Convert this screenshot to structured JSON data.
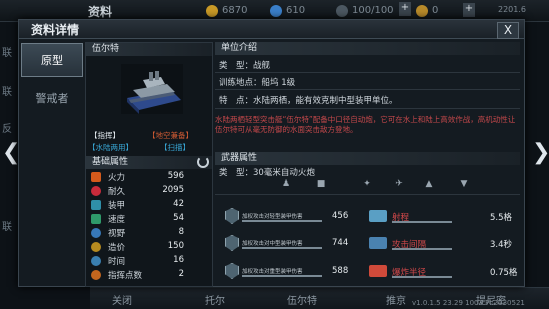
{
  "hud": {
    "title": "资料",
    "gold": "6870",
    "gems": "610",
    "energy": "100/100",
    "plus": "+",
    "coins": "0",
    "right": "2201.6"
  },
  "background": {
    "side_labels": [
      "联",
      "联",
      "反",
      "联"
    ],
    "nav": [
      "关闭",
      "托尔",
      "伍尔特",
      "推京",
      "提尼密"
    ],
    "version": "v1.0.1.5 23.29 1003 Pl:2030521"
  },
  "dialog": {
    "title": "资料详情",
    "close": "X",
    "tabs": [
      {
        "label": "原型",
        "active": true
      },
      {
        "label": "警戒者",
        "active": false
      }
    ],
    "unit_name": "伍尔特",
    "tags": {
      "rank": "【指挥】",
      "type": "【地空兼备】",
      "mobility": "【水陆两用】",
      "target": "【扫描】"
    },
    "base_stats_header": "基础属性",
    "refresh_icon": "refresh-icon",
    "stats": [
      {
        "icon": "fire-icon",
        "color": "#d35a1c",
        "label": "火力",
        "value": "596"
      },
      {
        "icon": "heart-icon",
        "color": "#c92b3b",
        "label": "耐久",
        "value": "2095"
      },
      {
        "icon": "armor-icon",
        "color": "#2f8fa8",
        "label": "装甲",
        "value": "42"
      },
      {
        "icon": "speed-icon",
        "color": "#2f9a6a",
        "label": "速度",
        "value": "54"
      },
      {
        "icon": "eye-icon",
        "color": "#3778b8",
        "label": "视野",
        "value": "8"
      },
      {
        "icon": "cost-icon",
        "color": "#b68a1f",
        "label": "造价",
        "value": "150"
      },
      {
        "icon": "clock-icon",
        "color": "#3a7fb0",
        "label": "时间",
        "value": "16"
      },
      {
        "icon": "cmd-icon",
        "color": "#c4661e",
        "label": "指挥点数",
        "value": "2"
      }
    ],
    "unit_info": {
      "header": "单位介绍",
      "type_label": "类　型：",
      "type_value": "战舰",
      "train_label": "训练地点：",
      "train_value": "船坞 1级",
      "feature_label": "特　点：",
      "feature_value": "水陆两栖，能有效克制中型装甲单位。",
      "description": "水陆两栖轻型突击艇“伍尔特”配备中口径自动炮，它可在水上和陆上高效作战，高机动性让伍尔特可从毫无防御的水面突击敌方登地。"
    },
    "weapon": {
      "header": "武器属性",
      "type_label": "类　型：",
      "type_value": "30毫米自动火炮",
      "target_icons": [
        "soldier-icon",
        "tank-icon",
        "helicopter-icon",
        "jet-icon",
        "ship-icon",
        "boat-icon"
      ],
      "rows": [
        {
          "caption": "加权攻击对轻型装甲伤害",
          "value": "456",
          "label2": "射程",
          "value2": "5.5格",
          "color2": "#5a9fc4"
        },
        {
          "caption": "加权攻击对中型装甲伤害",
          "value": "744",
          "label2": "攻击间隔",
          "value2": "3.4秒",
          "color2": "#4a82b0"
        },
        {
          "caption": "加权攻击对重型装甲伤害",
          "value": "588",
          "label2": "爆炸半径",
          "value2": "0.75格",
          "color2": "#d04a3a"
        }
      ]
    }
  }
}
